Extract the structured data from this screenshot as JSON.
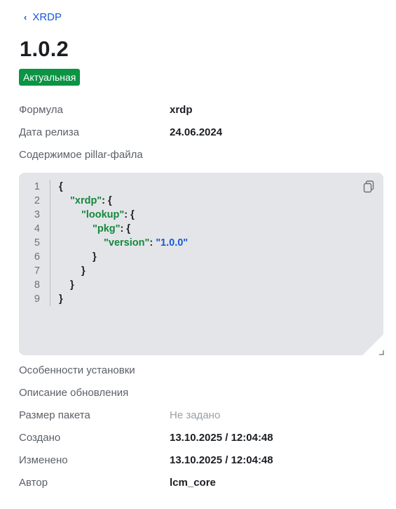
{
  "header": {
    "back_label": "XRDP",
    "title": "1.0.2",
    "status_badge": "Актуальная"
  },
  "fields_top": [
    {
      "label": "Формула",
      "value": "xrdp"
    },
    {
      "label": "Дата релиза",
      "value": "24.06.2024"
    }
  ],
  "pillar": {
    "label": "Содержимое pillar-файла",
    "line_numbers": [
      "1",
      "2",
      "3",
      "4",
      "5",
      "6",
      "7",
      "8",
      "9"
    ],
    "lines": [
      [
        {
          "t": "p",
          "v": "{"
        }
      ],
      [
        {
          "t": "k",
          "v": "\"xrdp\""
        },
        {
          "t": "p",
          "v": ": {"
        }
      ],
      [
        {
          "t": "k",
          "v": "\"lookup\""
        },
        {
          "t": "p",
          "v": ": {"
        }
      ],
      [
        {
          "t": "k",
          "v": "\"pkg\""
        },
        {
          "t": "p",
          "v": ": {"
        }
      ],
      [
        {
          "t": "k",
          "v": "\"version\""
        },
        {
          "t": "p",
          "v": ": "
        },
        {
          "t": "s",
          "v": "\"1.0.0\""
        }
      ],
      [
        {
          "t": "p",
          "v": "}"
        }
      ],
      [
        {
          "t": "p",
          "v": "}"
        }
      ],
      [
        {
          "t": "p",
          "v": "}"
        }
      ],
      [
        {
          "t": "p",
          "v": "}"
        }
      ]
    ],
    "indents": [
      0,
      1,
      2,
      3,
      4,
      3,
      2,
      1,
      0
    ],
    "copy_icon": "copy-icon"
  },
  "fields_bottom": [
    {
      "label": "Особенности установки",
      "value": ""
    },
    {
      "label": "Описание обновления",
      "value": ""
    },
    {
      "label": "Размер пакета",
      "value": "Не задано",
      "muted": true
    },
    {
      "label": "Создано",
      "value": "13.10.2025 / 12:04:48"
    },
    {
      "label": "Изменено",
      "value": "13.10.2025 / 12:04:48"
    },
    {
      "label": "Автор",
      "value": "lcm_core"
    }
  ]
}
